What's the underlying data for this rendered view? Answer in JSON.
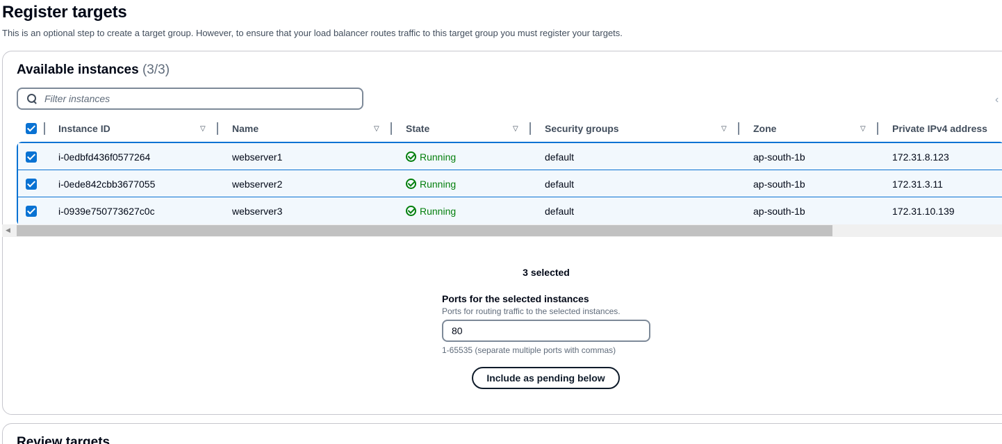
{
  "page": {
    "title": "Register targets",
    "description": "This is an optional step to create a target group. However, to ensure that your load balancer routes traffic to this target group you must register your targets."
  },
  "available": {
    "title": "Available instances",
    "count": "(3/3)",
    "filter_placeholder": "Filter instances",
    "columns": [
      "Instance ID",
      "Name",
      "State",
      "Security groups",
      "Zone",
      "Private IPv4 address"
    ],
    "rows": [
      {
        "id": "i-0edbfd436f0577264",
        "name": "webserver1",
        "state": "Running",
        "sg": "default",
        "zone": "ap-south-1b",
        "ip": "172.31.8.123"
      },
      {
        "id": "i-0ede842cbb3677055",
        "name": "webserver2",
        "state": "Running",
        "sg": "default",
        "zone": "ap-south-1b",
        "ip": "172.31.3.11"
      },
      {
        "id": "i-0939e750773627c0c",
        "name": "webserver3",
        "state": "Running",
        "sg": "default",
        "zone": "ap-south-1b",
        "ip": "172.31.10.139"
      }
    ],
    "selected_text": "3 selected",
    "ports_label": "Ports for the selected instances",
    "ports_desc": "Ports for routing traffic to the selected instances.",
    "ports_value": "80",
    "ports_hint": "1-65535 (separate multiple ports with commas)",
    "include_button": "Include as pending below"
  },
  "review": {
    "title": "Review targets"
  },
  "colors": {
    "accent": "#0972d3",
    "running": "#037f0c",
    "row_selected_bg": "#f2f8fd"
  },
  "icons": {
    "search": "search-icon",
    "status": "status-positive-icon",
    "sort": "sort-caret-icon",
    "checkbox": "checkbox-checked-icon"
  }
}
